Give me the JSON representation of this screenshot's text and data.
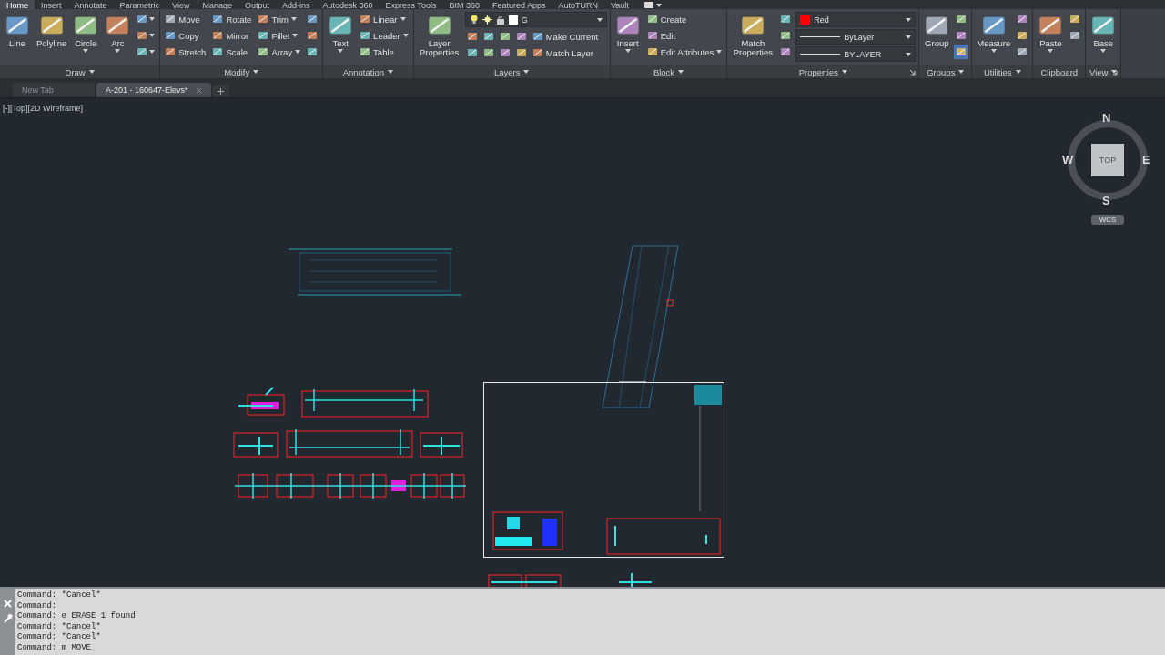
{
  "ribbon_tabs": [
    {
      "label": "Home",
      "selected": true
    },
    {
      "label": "Insert",
      "selected": false
    },
    {
      "label": "Annotate",
      "selected": false
    },
    {
      "label": "Parametric",
      "selected": false
    },
    {
      "label": "View",
      "selected": false
    },
    {
      "label": "Manage",
      "selected": false
    },
    {
      "label": "Output",
      "selected": false
    },
    {
      "label": "Add-ins",
      "selected": false
    },
    {
      "label": "Autodesk 360",
      "selected": false
    },
    {
      "label": "Express Tools",
      "selected": false
    },
    {
      "label": "BIM 360",
      "selected": false
    },
    {
      "label": "Featured Apps",
      "selected": false
    },
    {
      "label": "AutoTURN",
      "selected": false
    },
    {
      "label": "Vault",
      "selected": false
    }
  ],
  "panels": [
    {
      "title": "Draw",
      "dropdown": true,
      "launcher": false,
      "columns": [
        {
          "kind": "large",
          "label": "Line",
          "dropdown": false
        },
        {
          "kind": "large",
          "label": "Polyline",
          "dropdown": false
        },
        {
          "kind": "large",
          "label": "Circle",
          "dropdown": true
        },
        {
          "kind": "large",
          "label": "Arc",
          "dropdown": true
        },
        {
          "kind": "stack",
          "items": [
            {
              "kind": "icon",
              "dropdown": true
            },
            {
              "kind": "icon",
              "dropdown": true
            },
            {
              "kind": "icon",
              "dropdown": true
            }
          ]
        }
      ]
    },
    {
      "title": "Modify",
      "dropdown": true,
      "launcher": false,
      "columns": [
        {
          "kind": "stack",
          "items": [
            {
              "kind": "small",
              "label": "Move",
              "dropdown": false
            },
            {
              "kind": "small",
              "label": "Copy",
              "dropdown": false
            },
            {
              "kind": "small",
              "label": "Stretch",
              "dropdown": false
            }
          ]
        },
        {
          "kind": "stack",
          "items": [
            {
              "kind": "small",
              "label": "Rotate",
              "dropdown": false
            },
            {
              "kind": "small",
              "label": "Mirror",
              "dropdown": false
            },
            {
              "kind": "small",
              "label": "Scale",
              "dropdown": false
            }
          ]
        },
        {
          "kind": "stack",
          "items": [
            {
              "kind": "small",
              "label": "Trim",
              "dropdown": true
            },
            {
              "kind": "small",
              "label": "Fillet",
              "dropdown": true
            },
            {
              "kind": "small",
              "label": "Array",
              "dropdown": true
            }
          ]
        },
        {
          "kind": "stack",
          "items": [
            {
              "kind": "icon",
              "dropdown": false
            },
            {
              "kind": "icon",
              "dropdown": false
            },
            {
              "kind": "icon",
              "dropdown": false
            }
          ]
        }
      ]
    },
    {
      "title": "Annotation",
      "dropdown": true,
      "launcher": false,
      "columns": [
        {
          "kind": "large",
          "label": "Text",
          "dropdown": true
        },
        {
          "kind": "stack",
          "items": [
            {
              "kind": "small",
              "label": "Linear",
              "dropdown": true
            },
            {
              "kind": "small",
              "label": "Leader",
              "dropdown": true
            },
            {
              "kind": "small",
              "label": "Table",
              "dropdown": false
            }
          ]
        }
      ]
    },
    {
      "title": "Layers",
      "dropdown": true,
      "launcher": false,
      "columns": [
        {
          "kind": "large",
          "label": "Layer Properties",
          "dropdown": false
        },
        {
          "kind": "stack",
          "items": [
            {
              "kind": "combo",
              "value": "G"
            },
            {
              "kind": "row",
              "items": [
                {
                  "kind": "icon",
                  "dropdown": false
                },
                {
                  "kind": "icon",
                  "dropdown": false
                },
                {
                  "kind": "icon",
                  "dropdown": false
                },
                {
                  "kind": "icon",
                  "dropdown": false
                },
                {
                  "kind": "small",
                  "label": "Make Current",
                  "dropdown": false
                }
              ]
            },
            {
              "kind": "row",
              "items": [
                {
                  "kind": "icon",
                  "dropdown": false
                },
                {
                  "kind": "icon",
                  "dropdown": false
                },
                {
                  "kind": "icon",
                  "dropdown": false
                },
                {
                  "kind": "icon",
                  "dropdown": false
                },
                {
                  "kind": "small",
                  "label": "Match Layer",
                  "dropdown": false
                }
              ]
            }
          ]
        }
      ]
    },
    {
      "title": "Block",
      "dropdown": true,
      "launcher": false,
      "columns": [
        {
          "kind": "large",
          "label": "Insert",
          "dropdown": true
        },
        {
          "kind": "stack",
          "items": [
            {
              "kind": "small",
              "label": "Create",
              "dropdown": false
            },
            {
              "kind": "small",
              "label": "Edit",
              "dropdown": false
            },
            {
              "kind": "small",
              "label": "Edit Attributes",
              "dropdown": true
            }
          ]
        }
      ]
    },
    {
      "title": "Properties",
      "dropdown": true,
      "launcher": true,
      "columns": [
        {
          "kind": "large",
          "label": "Match Properties",
          "dropdown": false
        },
        {
          "kind": "stack",
          "items": [
            {
              "kind": "icon",
              "dropdown": false
            },
            {
              "kind": "icon",
              "dropdown": false
            },
            {
              "kind": "icon",
              "dropdown": false
            }
          ]
        },
        {
          "kind": "stack",
          "items": [
            {
              "kind": "colorcombo",
              "value": "Red",
              "color": "#ff0000"
            },
            {
              "kind": "linecombo",
              "value": "ByLayer"
            },
            {
              "kind": "linecombo",
              "value": "BYLAYER"
            }
          ]
        }
      ]
    },
    {
      "title": "Groups",
      "dropdown": true,
      "launcher": false,
      "columns": [
        {
          "kind": "large",
          "label": "Group",
          "dropdown": false
        },
        {
          "kind": "stack",
          "items": [
            {
              "kind": "icon",
              "dropdown": false,
              "on": false
            },
            {
              "kind": "icon",
              "dropdown": false,
              "on": false
            },
            {
              "kind": "icon",
              "dropdown": false,
              "on": true
            }
          ]
        }
      ]
    },
    {
      "title": "Utilities",
      "dropdown": true,
      "launcher": false,
      "columns": [
        {
          "kind": "large",
          "label": "Measure",
          "dropdown": true
        },
        {
          "kind": "stack",
          "items": [
            {
              "kind": "icon",
              "dropdown": false
            },
            {
              "kind": "icon",
              "dropdown": false
            },
            {
              "kind": "icon",
              "dropdown": false
            }
          ]
        }
      ]
    },
    {
      "title": "Clipboard",
      "dropdown": false,
      "launcher": false,
      "columns": [
        {
          "kind": "large",
          "label": "Paste",
          "dropdown": true
        },
        {
          "kind": "stack",
          "items": [
            {
              "kind": "icon",
              "dropdown": false
            },
            {
              "kind": "icon",
              "dropdown": false
            }
          ]
        }
      ]
    },
    {
      "title": "View",
      "dropdown": true,
      "launcher": true,
      "columns": [
        {
          "kind": "large",
          "label": "Base",
          "dropdown": true
        }
      ]
    }
  ],
  "file_tabs": [
    {
      "label": "New Tab",
      "selected": false,
      "closable": false
    },
    {
      "label": "A-201 - 160647-Elevs*",
      "selected": true,
      "closable": true
    }
  ],
  "viewport": {
    "label": "[-][Top][2D Wireframe]"
  },
  "viewcube": {
    "face": "TOP",
    "north": "N",
    "east": "E",
    "south": "S",
    "west": "W",
    "ucs": "WCS"
  },
  "command_history": [
    "Command: *Cancel*",
    "Command:",
    "Command: e ERASE 1 found",
    "Command: *Cancel*",
    "Command: *Cancel*",
    "Command: m MOVE"
  ]
}
